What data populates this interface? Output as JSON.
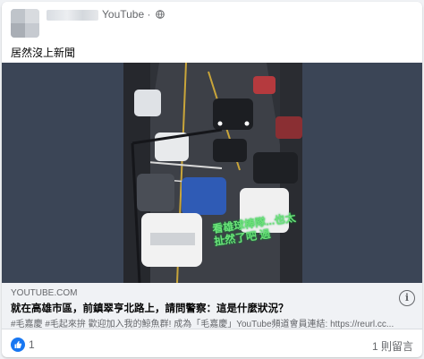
{
  "post": {
    "author_suffix": "YouTube",
    "privacy": "·",
    "text": "居然沒上新聞"
  },
  "video": {
    "overlay_text": "看雄球棒隊...也太扯然了吧 過"
  },
  "link": {
    "domain": "YOUTUBE.COM",
    "title": "就在高雄市區，前鎮翠亨北路上，請問警察：這是什麼狀況？",
    "description": "#毛嘉慶 #毛起來拚 歡迎加入我的鯨魚群! 成為「毛嘉慶」YouTube頻道會員連結: https://reurl.cc...",
    "info_symbol": "i"
  },
  "footer": {
    "like_count": "1",
    "comment_count": "1 則留言"
  },
  "colors": {
    "accent": "#1877f2",
    "secondary_text": "#65676b",
    "overlay_green": "#6ee07a"
  }
}
